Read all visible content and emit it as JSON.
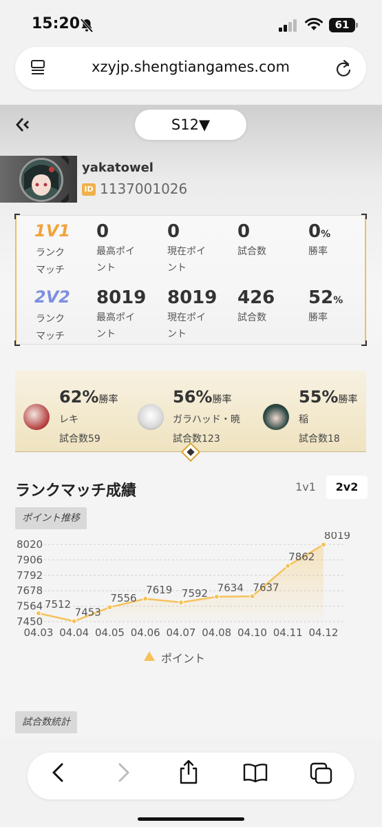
{
  "status_bar": {
    "time": "15:20",
    "battery": "61"
  },
  "browser": {
    "url": "xzyjp.shengtiangames.com"
  },
  "season": {
    "label": "S12▼"
  },
  "profile": {
    "username": "yakatowel",
    "id_label": "ID",
    "id_value": "1137001026"
  },
  "stats": {
    "rows": [
      {
        "mode": "1V1",
        "sub1": "ランク",
        "sub2": "マッチ",
        "items": [
          {
            "value": "0",
            "label1": "最高ポイ",
            "label2": "ント"
          },
          {
            "value": "0",
            "label1": "現在ポイ",
            "label2": "ント"
          },
          {
            "value": "0",
            "label1": "試合数",
            "label2": ""
          },
          {
            "value": "0",
            "unit": "%",
            "label1": "勝率",
            "label2": ""
          }
        ]
      },
      {
        "mode": "2V2",
        "sub1": "ランク",
        "sub2": "マッチ",
        "items": [
          {
            "value": "8019",
            "label1": "最高ポイ",
            "label2": "ント"
          },
          {
            "value": "8019",
            "label1": "現在ポイ",
            "label2": "ント"
          },
          {
            "value": "426",
            "label1": "試合数",
            "label2": ""
          },
          {
            "value": "52",
            "unit": "%",
            "label1": "勝率",
            "label2": ""
          }
        ]
      }
    ]
  },
  "heroes": [
    {
      "pct": "62%",
      "pct_label": "勝率",
      "name": "レキ",
      "count": "試合数59"
    },
    {
      "pct": "56%",
      "pct_label": "勝率",
      "name": "ガラハッド・暁",
      "count": "試合数123"
    },
    {
      "pct": "55%",
      "pct_label": "勝率",
      "name": "稲",
      "count": "試合数18"
    }
  ],
  "rank_record": {
    "title": "ランクマッチ成績",
    "tabs": [
      "1v1",
      "2v2"
    ],
    "active_tab": "2v2",
    "points_tag": "ポイント推移",
    "stats_tag": "試合数統計"
  },
  "chart_data": {
    "type": "area",
    "categories": [
      "04.03",
      "04.04",
      "04.05",
      "04.06",
      "04.07",
      "04.08",
      "04.10",
      "04.11",
      "04.12"
    ],
    "series": [
      {
        "name": "ポイント",
        "values": [
          7512,
          7453,
          7556,
          7619,
          7592,
          7634,
          7637,
          7862,
          8019
        ],
        "color": "#f5c25b"
      }
    ],
    "y_ticks": [
      7450,
      7564,
      7678,
      7792,
      7906,
      8020
    ],
    "ylim": [
      7450,
      8020
    ],
    "grid": true,
    "legend": "bottom-center"
  }
}
